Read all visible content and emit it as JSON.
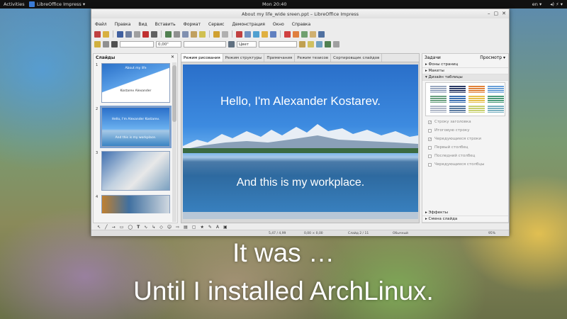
{
  "topbar": {
    "activities": "Activities",
    "app_name": "LibreOffice Impress ▾",
    "clock": "Mon 20:40",
    "lang": "en ▾",
    "status": "◂) ⚡ ▾"
  },
  "window": {
    "title": "About my life_wide sreen.ppt – LibreOffice Impress",
    "close": "✕",
    "maximize": "▢",
    "minimize": "–"
  },
  "menu": [
    "Файл",
    "Правка",
    "Вид",
    "Вставить",
    "Формат",
    "Сервис",
    "Демонстрация",
    "Окно",
    "Справка"
  ],
  "toolbar2": {
    "line_width": "0,00\"",
    "color_name": "Цвет"
  },
  "slides_panel": {
    "title": "Слайды",
    "close": "✕",
    "slides": [
      {
        "num": "1",
        "title": "About my life",
        "subtitle": "Kostarev Alexander"
      },
      {
        "num": "2",
        "title": "Hello, I'm Alexander Kostarev.",
        "subtitle": "And this is my workplace."
      },
      {
        "num": "3",
        "title": "",
        "subtitle": ""
      },
      {
        "num": "4",
        "title": "",
        "subtitle": ""
      }
    ]
  },
  "tabs": [
    "Режим рисования",
    "Режим структуры",
    "Примечания",
    "Режим тезисов",
    "Сортировщик слайдов"
  ],
  "slide": {
    "heading": "Hello, I'm Alexander Kostarev.",
    "subheading": "And this is my workplace."
  },
  "tasks_panel": {
    "title": "Задачи",
    "view": "Просмотр ▾",
    "sections": [
      "Фоны страниц",
      "Макеты",
      "Дизайн таблицы"
    ],
    "options": [
      "Строку заголовка",
      "Итоговую строку",
      "Чередующиеся строки",
      "Первый столбец",
      "Последний столбец",
      "Чередующиеся столбцы"
    ],
    "options_checked": [
      true,
      false,
      true,
      false,
      false,
      false
    ],
    "bottom_sections": [
      "Эффекты",
      "Смена слайда"
    ],
    "swatch_colors": [
      "#9aa8c0",
      "#2b3a66",
      "#e0823a",
      "#6aa0d8",
      "#6aa080",
      "#3b6fb0",
      "#e6c04a",
      "#4a9a7a",
      "#b0b8c8",
      "#5a7aa0",
      "#c8d070",
      "#7ab0c0"
    ]
  },
  "drawbar": {
    "text_tool": "T"
  },
  "status": {
    "position": "5,47 / 4,99",
    "size": "0,00 × 0,00",
    "slide": "Слайд 2 / 11",
    "layout": "Обычный",
    "zoom": "95%"
  },
  "caption": {
    "line1": "It was …",
    "line2": "Until I installed ArchLinux."
  }
}
